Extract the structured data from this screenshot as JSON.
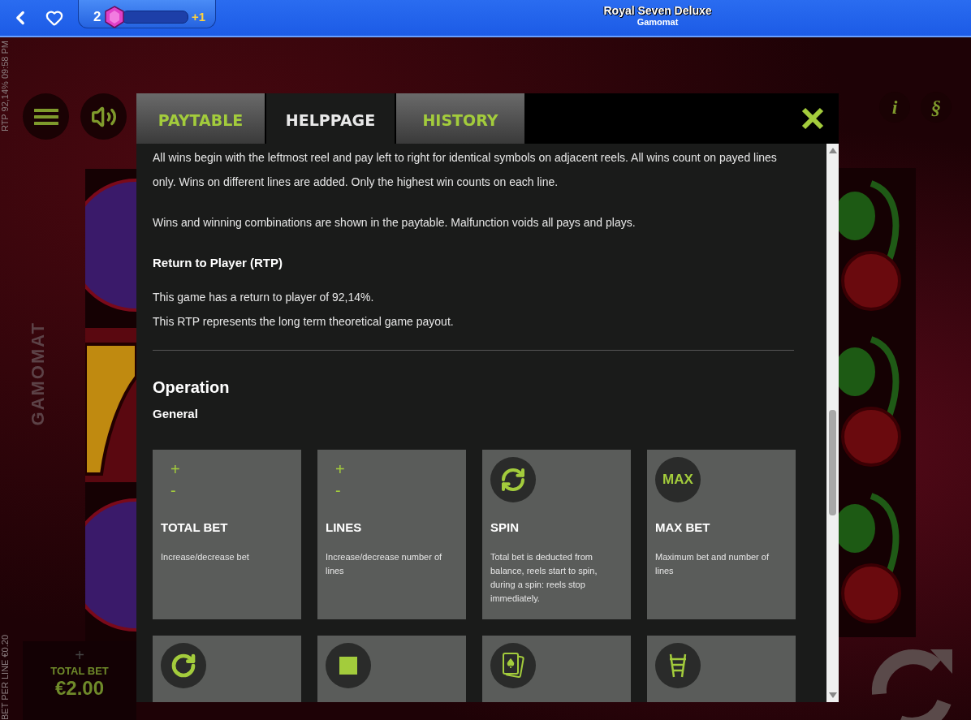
{
  "top_bar": {
    "level_badge": {
      "number": "2",
      "bonus": "+1",
      "level": 0
    },
    "title": "Royal Seven Deluxe",
    "subtitle": "Gamomat"
  },
  "game": {
    "side_info_top": "RTP 92,14% 09:58 PM",
    "side_info_bottom": "BET PER LINE €0.20",
    "brand": "GAMOMAT",
    "info_symbol": "i",
    "rules_symbol": "§",
    "total_bet": {
      "plus": "+",
      "label": "TOTAL BET",
      "value": "€2.00"
    }
  },
  "dialog": {
    "tabs": [
      {
        "label": "PAYTABLE",
        "selected": false
      },
      {
        "label": "HELPPAGE",
        "selected": true
      },
      {
        "label": "HISTORY",
        "selected": false
      }
    ],
    "blocks": [
      {
        "kind": "paragraph",
        "text": "All wins begin with the leftmost reel and pay left to right for identical symbols on adjacent reels. All wins count on payed lines only. Wins on different lines are added. Only the highest win counts on each line."
      },
      {
        "kind": "paragraph",
        "text": "Wins and winning combinations are shown in the paytable. Malfunction voids all pays and plays."
      },
      {
        "kind": "bold",
        "text": "Return to Player (RTP)"
      },
      {
        "kind": "lines",
        "lines": [
          "This game has a return to player of 92,14%.",
          "This RTP represents the long term theoretical game payout."
        ]
      },
      {
        "kind": "divider"
      },
      {
        "kind": "heading",
        "text": "Operation"
      },
      {
        "kind": "subheading",
        "text": "General"
      }
    ],
    "cards": [
      {
        "kind": "plus_minus",
        "plus": "+",
        "minus": "-",
        "title": "TOTAL BET",
        "description": "Increase/decrease bet"
      },
      {
        "kind": "plus_minus",
        "plus": "+",
        "minus": "-",
        "title": "LINES",
        "description": "Increase/decrease number of lines"
      },
      {
        "kind": "spin",
        "title": "SPIN",
        "description": "Total bet is deducted from balance, reels start to spin, during a spin: reels stop immediately."
      },
      {
        "kind": "max",
        "icon_text": "MAX",
        "title": "MAX BET",
        "description": "Maximum bet and number of lines"
      },
      {
        "kind": "autoplay"
      },
      {
        "kind": "stop"
      },
      {
        "kind": "cards"
      },
      {
        "kind": "ladder"
      }
    ]
  }
}
